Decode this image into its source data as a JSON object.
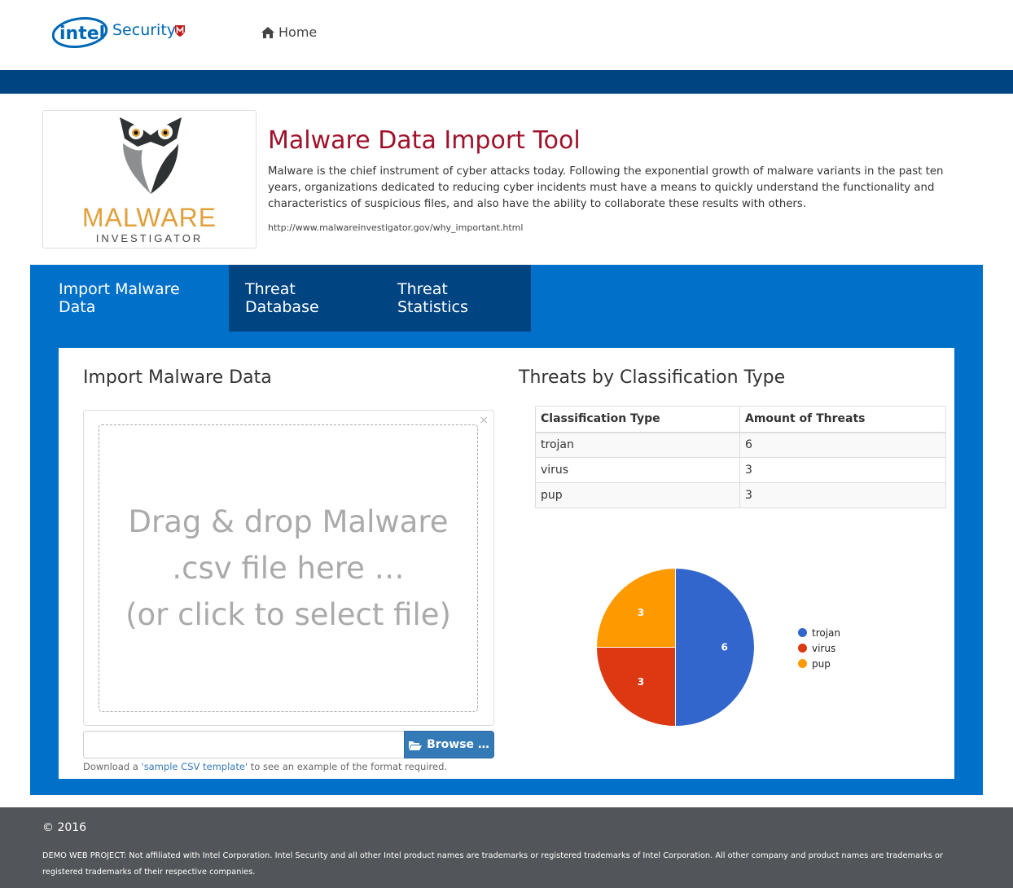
{
  "nav": {
    "brand": "Security",
    "home_label": "Home"
  },
  "hero": {
    "logo_title": "MALWARE",
    "logo_subtitle": "INVESTIGATOR",
    "title": "Malware Data Import Tool",
    "description": "Malware is the chief instrument of cyber attacks today. Following the exponential growth of malware variants in the past ten years, organizations dedicated to reducing cyber incidents must have a means to quickly understand the functionality and characteristics of suspicious files, and also have the ability to collaborate these results with others.",
    "source_url": "http://www.malwareinvestigator.gov/why_important.html"
  },
  "tabs": [
    {
      "label": "Import Malware Data"
    },
    {
      "label": "Threat Database"
    },
    {
      "label": "Threat Statistics"
    }
  ],
  "import": {
    "heading": "Import Malware Data",
    "drop_lines": [
      "Drag & drop Malware",
      ".csv file here …",
      "(or click to select file)"
    ],
    "close_glyph": "×",
    "browse_label": "Browse …",
    "help_prefix": "Download a ",
    "help_link": "'sample CSV template'",
    "help_suffix": " to see an example of the format required."
  },
  "stats": {
    "heading": "Threats by Classification Type",
    "columns": [
      "Classification Type",
      "Amount of Threats"
    ],
    "rows": [
      {
        "type": "trojan",
        "amount": "6"
      },
      {
        "type": "virus",
        "amount": "3"
      },
      {
        "type": "pup",
        "amount": "3"
      }
    ]
  },
  "chart_data": {
    "type": "pie",
    "categories": [
      "trojan",
      "virus",
      "pup"
    ],
    "values": [
      6,
      3,
      3
    ],
    "colors": [
      "#3366cc",
      "#dc3912",
      "#ff9900"
    ],
    "legend": "right"
  },
  "footer": {
    "copyright": "© 2016",
    "disclaimer": "DEMO WEB PROJECT: Not affiliated with Intel Corporation. Intel Security and all other Intel product names are trademarks or registered trademarks of Intel Corporation. All other company and product names are trademarks or registered trademarks of their respective companies."
  }
}
